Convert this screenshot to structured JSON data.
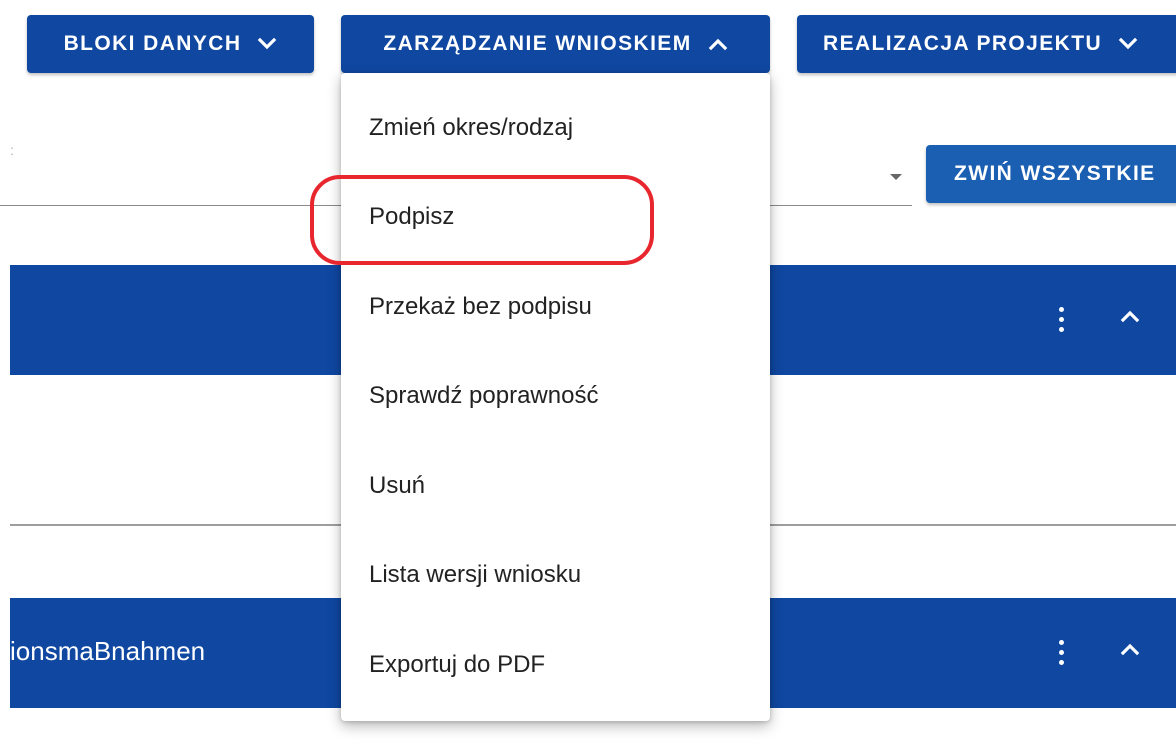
{
  "toolbar": {
    "data_blocks_label": "BLOKI DANYCH",
    "application_management_label": "ZARZĄDZANIE WNIOSKIEM",
    "project_realization_label": "REALIZACJA PROJEKTU"
  },
  "collapse_all_label": "ZWIŃ WSZYSTKIE",
  "sections": [
    {
      "title": ""
    },
    {
      "title": "ionsmaBnahmen"
    }
  ],
  "menu": {
    "items": [
      "Zmień okres/rodzaj",
      "Podpisz",
      "Przekaż bez podpisu",
      "Sprawdź poprawność",
      "Usuń",
      "Lista wersji wniosku",
      "Exportuj do PDF"
    ],
    "highlighted_item": "Podpisz"
  },
  "colors": {
    "primary": "#0f47a1",
    "button_secondary": "#1b5fb3",
    "highlight": "#e8262d"
  },
  "icons": {
    "dropdown_closed": "chevron-down-icon",
    "dropdown_open": "chevron-up-icon",
    "more_actions": "more-vert-icon",
    "select_caret": "caret-down-icon"
  }
}
